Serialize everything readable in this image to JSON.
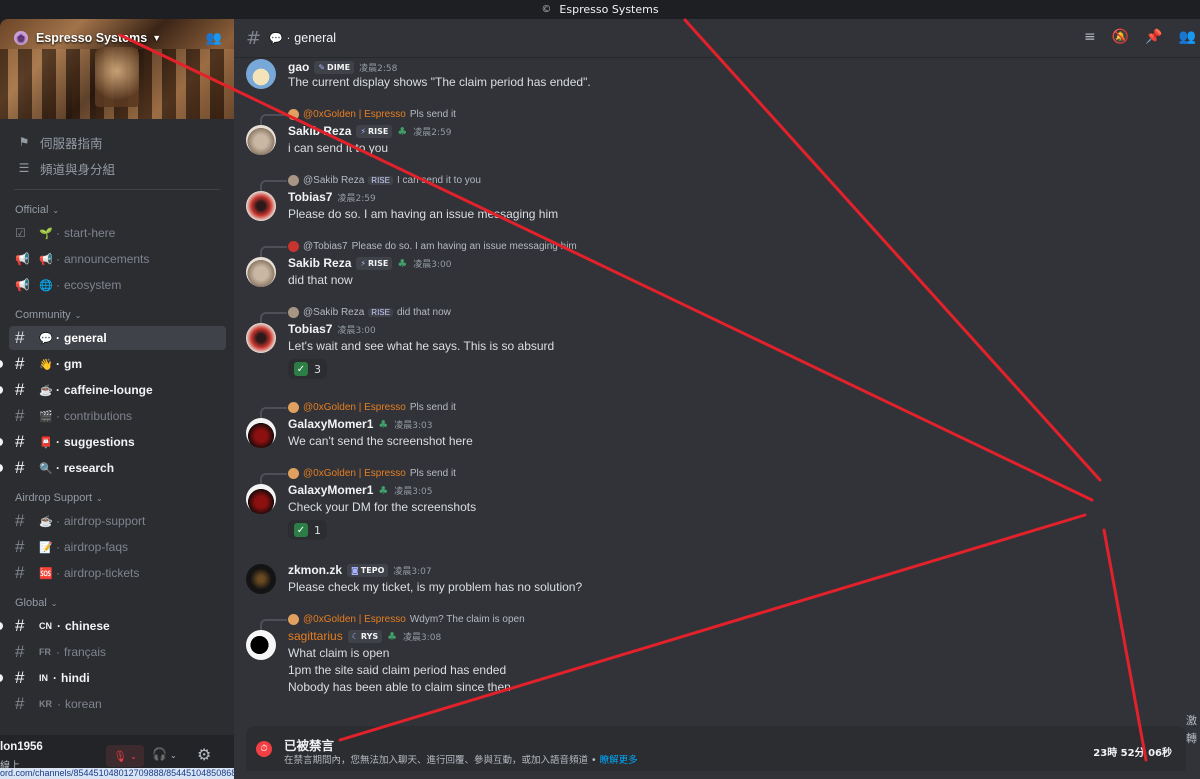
{
  "window": {
    "title": "Espresso Systems",
    "logo": "©"
  },
  "server": {
    "name": "Espresso Systems"
  },
  "nav": [
    {
      "label": "伺服器指南",
      "icon": "signpost-icon"
    },
    {
      "label": "頻道與身分組",
      "icon": "channels-roles-icon"
    }
  ],
  "categories": {
    "official": "Official",
    "community": "Community",
    "airdrop": "Airdrop Support",
    "global": "Global"
  },
  "channels": {
    "start_here": {
      "emoji": "🌱",
      "name": "start-here"
    },
    "announcements": {
      "emoji": "📢",
      "name": "announcements"
    },
    "ecosystem": {
      "emoji": "🌐",
      "name": "ecosystem"
    },
    "general": {
      "emoji": "💬",
      "name": "general"
    },
    "gm": {
      "emoji": "👋",
      "name": "gm"
    },
    "caffeine": {
      "emoji": "☕",
      "name": "caffeine-lounge"
    },
    "contributions": {
      "emoji": "🎬",
      "name": "contributions"
    },
    "suggestions": {
      "emoji": "📮",
      "name": "suggestions"
    },
    "research": {
      "emoji": "🔍",
      "name": "research"
    },
    "airdrop_support": {
      "emoji": "☕",
      "name": "airdrop-support"
    },
    "airdrop_faqs": {
      "emoji": "📝",
      "name": "airdrop-faqs"
    },
    "airdrop_tickets": {
      "emoji": "🆘",
      "name": "airdrop-tickets"
    },
    "chinese": {
      "prefix": "CN",
      "name": "chinese"
    },
    "francais": {
      "prefix": "FR",
      "name": "français"
    },
    "hindi": {
      "prefix": "IN",
      "name": "hindi"
    },
    "korean": {
      "prefix": "KR",
      "name": "korean"
    }
  },
  "user": {
    "name": "lon1956",
    "status": "線上"
  },
  "status_url": "ord.com/channels/854451048012709888/854451048508686346",
  "header": {
    "channel": "general",
    "emoji": "💬"
  },
  "messages": {
    "m1": {
      "user": "gao",
      "tag": "DIME",
      "time": "凌晨2:58",
      "text": "The current display shows \"The claim period has ended\"."
    },
    "m2": {
      "reply_user": "@0xGolden | Espresso",
      "reply_text": "Pls send it",
      "user": "Sakib Reza",
      "tag": "RISE",
      "time": "凌晨2:59",
      "text": "i can send it to you"
    },
    "m3": {
      "reply_user": "@Sakib Reza",
      "reply_tag": "RISE",
      "reply_text": "I can send it to you",
      "user": "Tobias7",
      "time": "凌晨2:59",
      "text": "Please do so. I am having an issue messaging him"
    },
    "m4": {
      "reply_user": "@Tobias7",
      "reply_text": "Please do so. I am having an issue messaging him",
      "user": "Sakib Reza",
      "tag": "RISE",
      "time": "凌晨3:00",
      "text": "did that now"
    },
    "m5": {
      "reply_user": "@Sakib Reza",
      "reply_tag": "RISE",
      "reply_text": "did that now",
      "user": "Tobias7",
      "time": "凌晨3:00",
      "text": "Let's wait and see what he says. This is so absurd",
      "reaction": "3"
    },
    "m6": {
      "reply_user": "@0xGolden | Espresso",
      "reply_text": "Pls send it",
      "user": "GalaxyMomer1",
      "time": "凌晨3:03",
      "text": "We can't send the screenshot here"
    },
    "m7": {
      "reply_user": "@0xGolden | Espresso",
      "reply_text": "Pls send it",
      "user": "GalaxyMomer1",
      "time": "凌晨3:05",
      "text": "Check your DM for the screenshots",
      "reaction": "1"
    },
    "m8": {
      "user": "zkmon.zk",
      "tag": "TEPO",
      "time": "凌晨3:07",
      "text": "Please check my ticket, is my problem has no solution?"
    },
    "m9": {
      "reply_user": "@0xGolden | Espresso",
      "reply_text": "Wdym? The claim is open",
      "user": "sagittarius",
      "tag": "RYS",
      "time": "凌晨3:08",
      "line1": "What claim is open",
      "line2": "1pm the site said claim period has ended",
      "line3": "Nobody has been able to claim since then"
    }
  },
  "banned": {
    "title": "已被禁言",
    "desc": "在禁言期間內，您無法加入聊天、進行回覆、參與互動，或加入語音頻道 • ",
    "link": "瞭解更多",
    "timer": "23時 52分 06秒"
  },
  "side_text": {
    "a": "激",
    "b": "轉"
  },
  "colors": {
    "annotation_red": "#e3212b",
    "accent_orange": "#e67e22",
    "muted_red": "#f23f43"
  }
}
